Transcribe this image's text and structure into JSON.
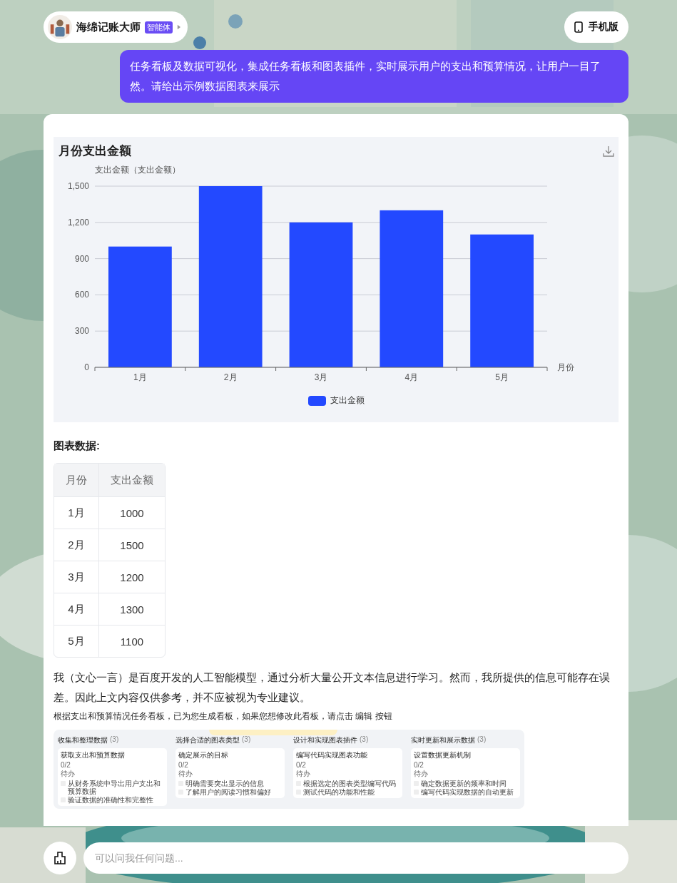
{
  "header": {
    "name": "海绵记账大师",
    "badge": "智能体",
    "mobile_button": "手机版"
  },
  "user_message": "任务看板及数据可视化，集成任务看板和图表插件，实时展示用户的支出和预算情况，让用户一目了然。请给出示例数据图表来展示",
  "chart_data": {
    "type": "bar",
    "title": "月份支出金额",
    "xlabel": "月份",
    "ylabel": "支出金额（支出金额）",
    "categories": [
      "1月",
      "2月",
      "3月",
      "4月",
      "5月"
    ],
    "series": [
      {
        "name": "支出金额",
        "color": "#2349ff",
        "values": [
          1000,
          1500,
          1200,
          1300,
          1100
        ]
      }
    ],
    "ylim": [
      0,
      1500
    ],
    "grid": true,
    "yticks": [
      {
        "value": 0,
        "label": "0"
      },
      {
        "value": 300,
        "label": "300"
      },
      {
        "value": 600,
        "label": "600"
      },
      {
        "value": 900,
        "label": "900"
      },
      {
        "value": 1200,
        "label": "1,200"
      },
      {
        "value": 1500,
        "label": "1,500"
      }
    ]
  },
  "table_title": "图表数据:",
  "table": {
    "columns": [
      "月份",
      "支出金额"
    ],
    "rows": [
      [
        "1月",
        "1000"
      ],
      [
        "2月",
        "1500"
      ],
      [
        "3月",
        "1200"
      ],
      [
        "4月",
        "1300"
      ],
      [
        "5月",
        "1100"
      ]
    ]
  },
  "disclaimer": "我（文心一言）是百度开发的人工智能模型，通过分析大量公开文本信息进行学习。然而，我所提供的信息可能存在误差。因此上文内容仅供参考，并不应被视为专业建议。",
  "kanban_note": "根据支出和预算情况任务看板，已为您生成看板，如果您想修改此看板，请点击 编辑 按钮",
  "kanban": {
    "columns": [
      {
        "title": "收集和整理数据",
        "count": "(3)",
        "cards": [
          {
            "title": "获取支出和预算数据",
            "progress": "0/2",
            "group": "待办",
            "tasks": [
              {
                "text": "从财务系统中导出用户支出和预算数据",
                "checked": false
              },
              {
                "text": "验证数据的准确性和完整性",
                "checked": false
              }
            ]
          }
        ]
      },
      {
        "title": "选择合适的图表类型",
        "count": "(3)",
        "cards": [
          {
            "title": "确定展示的目标",
            "progress": "0/2",
            "group": "待办",
            "tasks": [
              {
                "text": "明确需要突出显示的信息",
                "checked": false
              },
              {
                "text": "了解用户的阅读习惯和偏好",
                "checked": false
              }
            ]
          }
        ]
      },
      {
        "title": "设计和实现图表插件",
        "count": "(3)",
        "cards": [
          {
            "title": "编写代码实现图表功能",
            "progress": "0/2",
            "group": "待办",
            "tasks": [
              {
                "text": "根据选定的图表类型编写代码",
                "checked": false
              },
              {
                "text": "测试代码的功能和性能",
                "checked": false
              }
            ]
          }
        ]
      },
      {
        "title": "实时更新和展示数据",
        "count": "(3)",
        "cards": [
          {
            "title": "设置数据更新机制",
            "progress": "0/2",
            "group": "待办",
            "tasks": [
              {
                "text": "确定数据更新的频率和时间",
                "checked": false
              },
              {
                "text": "编写代码实现数据的自动更新",
                "checked": false
              }
            ]
          }
        ]
      }
    ]
  },
  "input": {
    "placeholder": "可以问我任何问题..."
  }
}
